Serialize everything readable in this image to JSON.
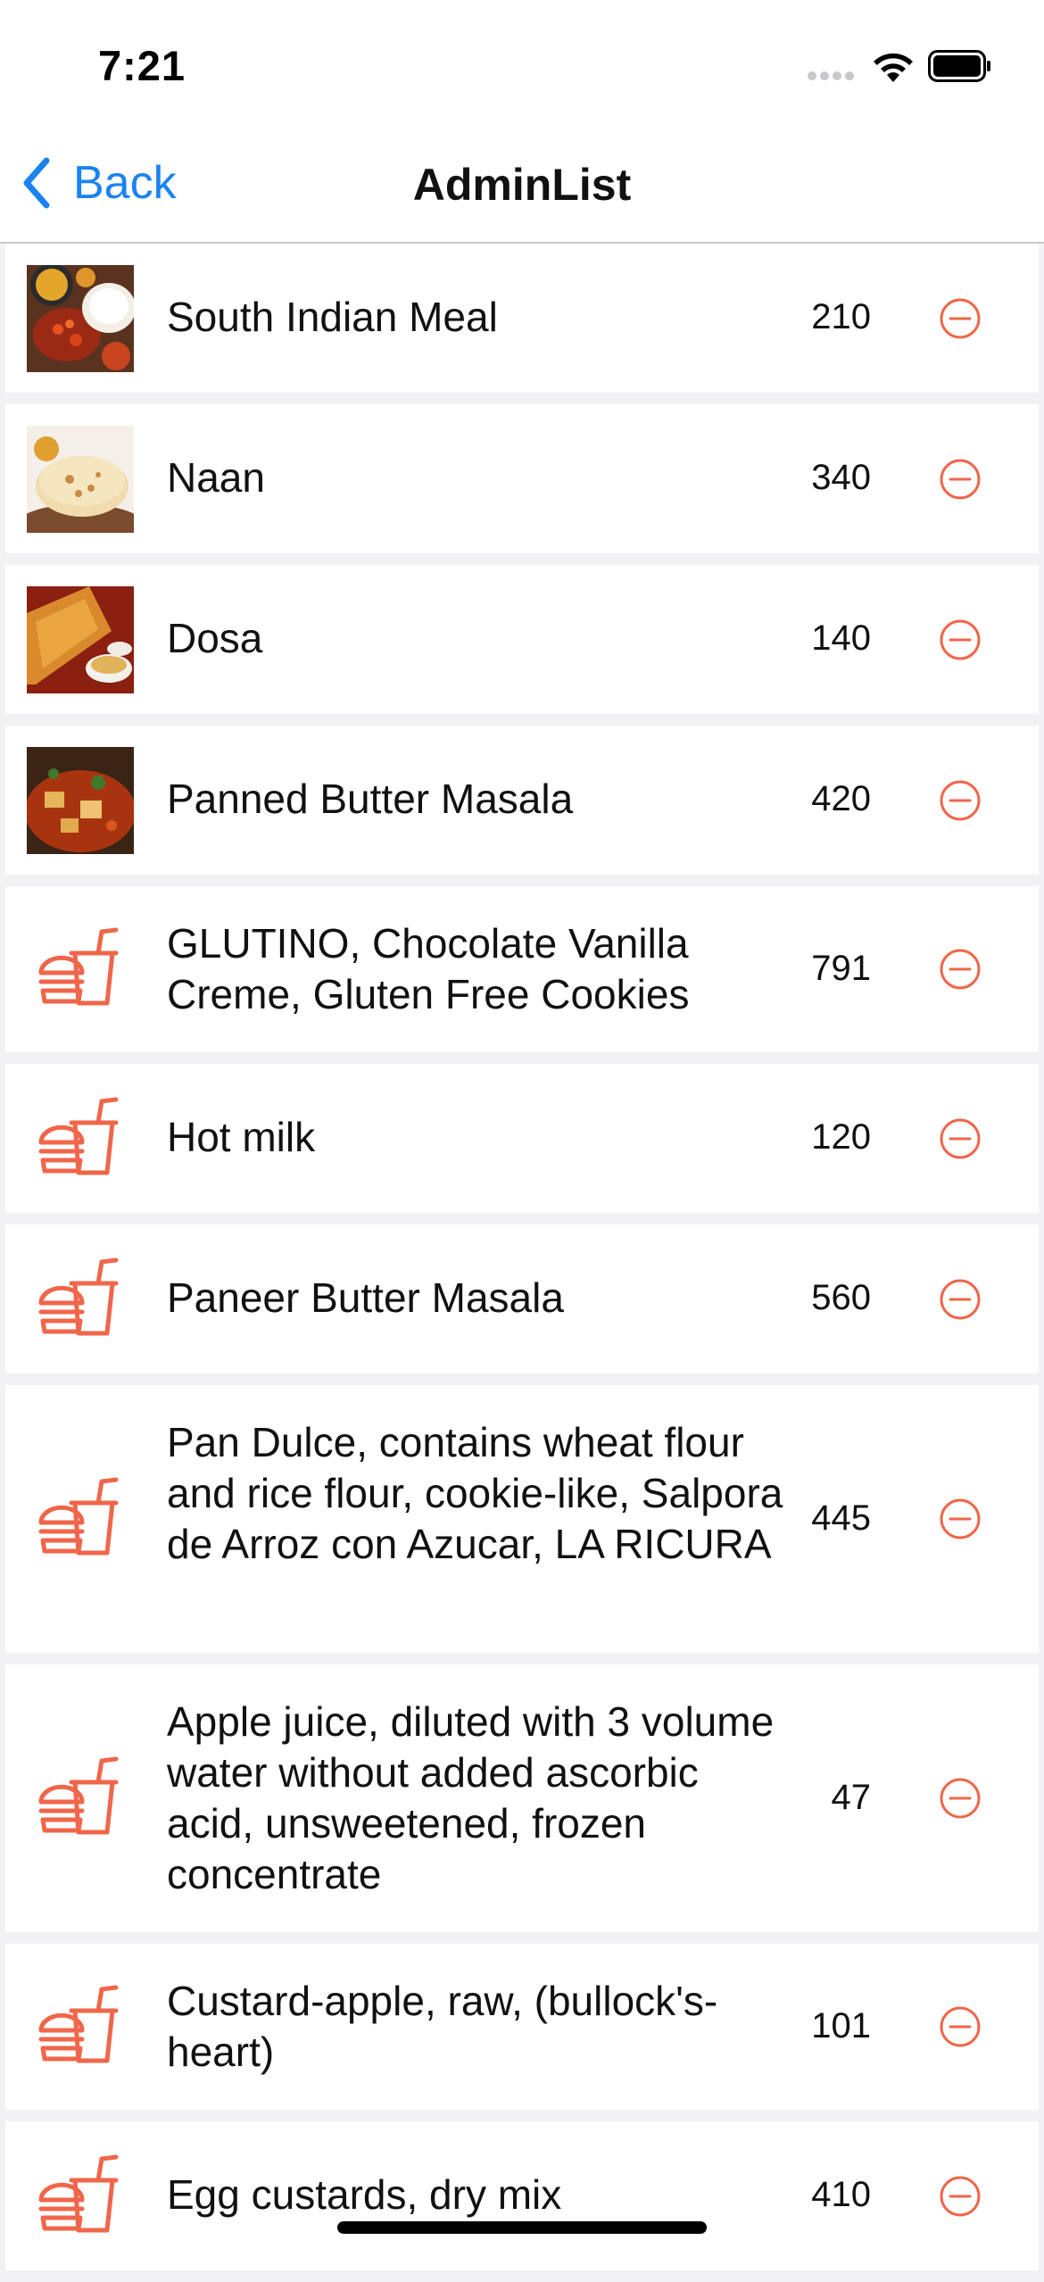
{
  "status_bar": {
    "time": "7:21"
  },
  "nav": {
    "back_label": "Back",
    "title": "AdminList"
  },
  "colors": {
    "accent": "#1a83f0",
    "remove": "#f0664a",
    "food_icon": "#f0664a"
  },
  "items": [
    {
      "name": "South Indian Meal",
      "price": "210",
      "icon": "photo-south-indian-meal"
    },
    {
      "name": "Naan",
      "price": "340",
      "icon": "photo-naan"
    },
    {
      "name": "Dosa",
      "price": "140",
      "icon": "photo-dosa"
    },
    {
      "name": "Panned Butter Masala",
      "price": "420",
      "icon": "photo-butter-masala"
    },
    {
      "name": "GLUTINO, Chocolate Vanilla Creme, Gluten Free Cookies",
      "price": "791",
      "icon": "fast-food-icon"
    },
    {
      "name": "Hot milk",
      "price": "120",
      "icon": "fast-food-icon"
    },
    {
      "name": "Paneer Butter Masala",
      "price": "560",
      "icon": "fast-food-icon"
    },
    {
      "name": "Pan Dulce, contains wheat flour and rice flour, cookie-like, Salpora de Arroz con Azucar, LA RICURA",
      "price": "445",
      "icon": "fast-food-icon"
    },
    {
      "name": "Apple juice, diluted with 3 volume water without added ascorbic acid, unsweetened, frozen concentrate",
      "price": "47",
      "icon": "fast-food-icon"
    },
    {
      "name": "Custard-apple, raw, (bullock's-heart)",
      "price": "101",
      "icon": "fast-food-icon"
    },
    {
      "name": "Egg custards, dry mix",
      "price": "410",
      "icon": "fast-food-icon"
    }
  ]
}
